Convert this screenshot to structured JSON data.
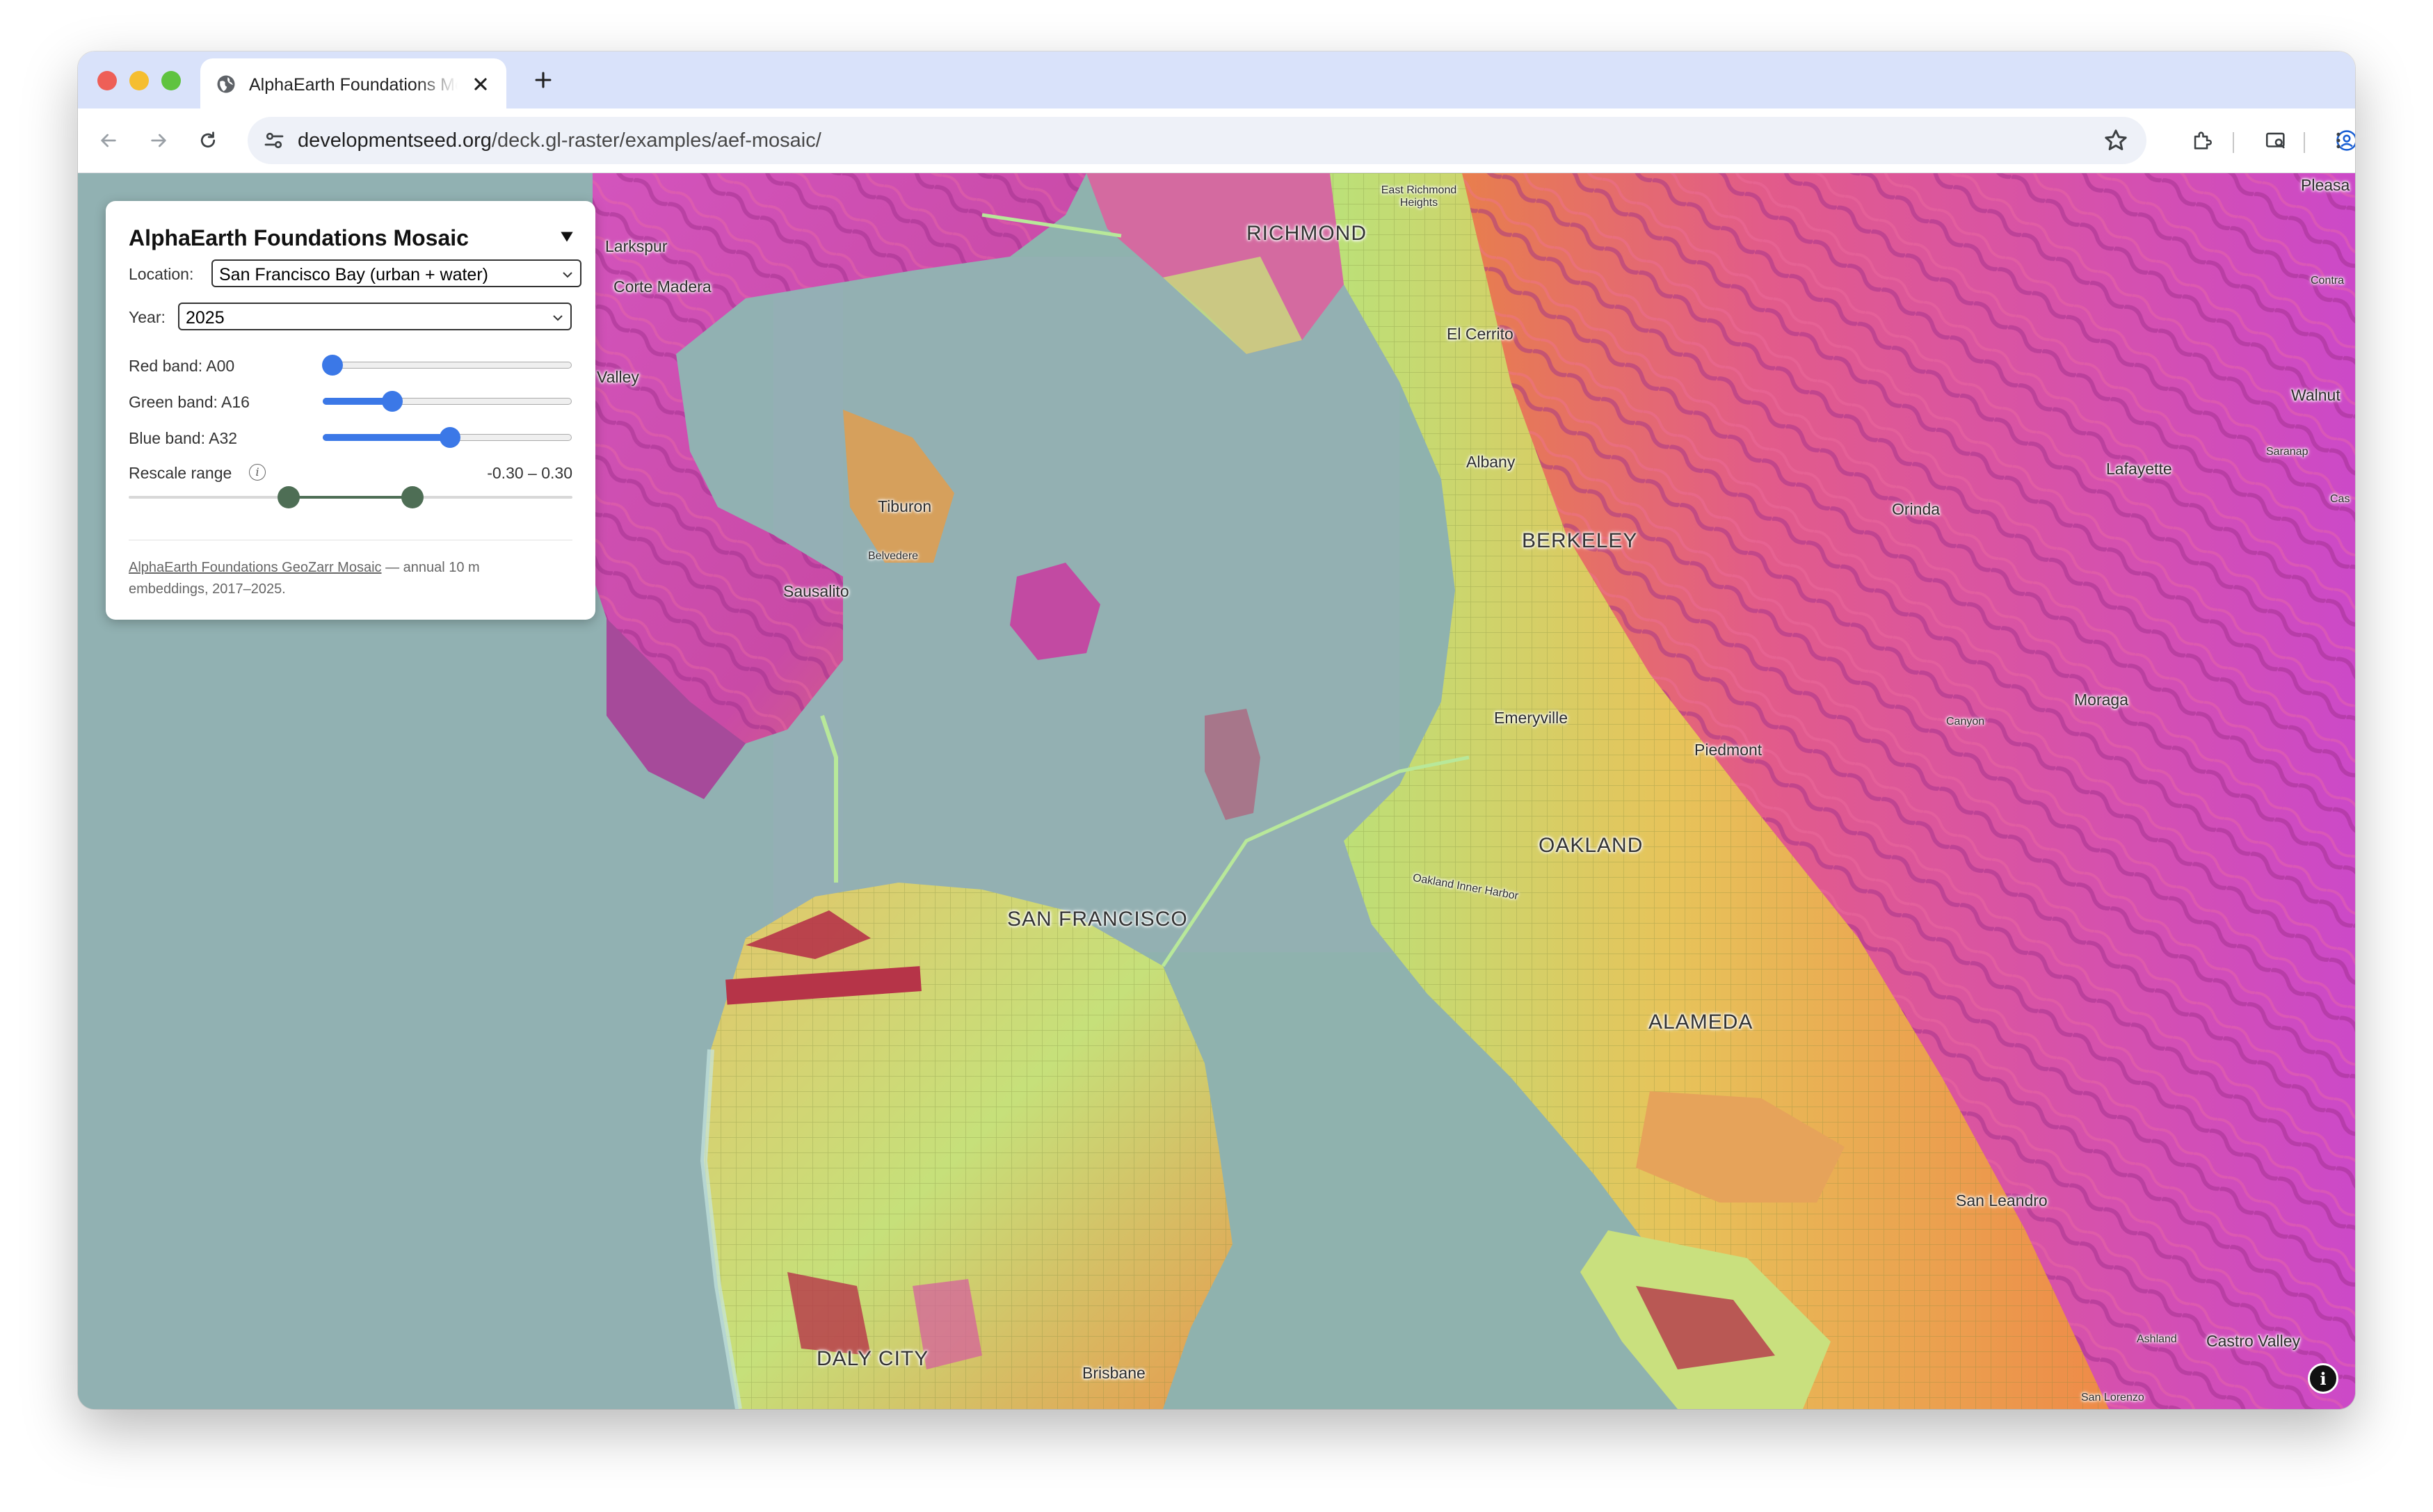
{
  "browser": {
    "tab_title": "AlphaEarth Foundations Mosaic",
    "url_domain": "developmentseed.org",
    "url_path": "/deck.gl-raster/examples/aef-mosaic/"
  },
  "panel": {
    "title": "AlphaEarth Foundations Mosaic",
    "location_label": "Location:",
    "location_value": "San Francisco Bay (urban + water)",
    "year_label": "Year:",
    "year_value": "2025",
    "red_band_label": "Red band: A00",
    "green_band_label": "Green band: A16",
    "blue_band_label": "Blue band: A32",
    "red_band_fraction": 0.04,
    "green_band_fraction": 0.28,
    "blue_band_fraction": 0.51,
    "rescale_label": "Rescale range",
    "rescale_value": "-0.30 – 0.30",
    "rescale_low_fraction": 0.36,
    "rescale_high_fraction": 0.64,
    "footer_link": "AlphaEarth Foundations GeoZarr Mosaic",
    "footer_text": " — annual 10 m embeddings, 2017–2025."
  },
  "map_labels": {
    "richmond": "RICHMOND",
    "east_richmond_heights": "East Richmond Heights",
    "el_cerrito": "El Cerrito",
    "albany": "Albany",
    "berkeley": "BERKELEY",
    "emeryville": "Emeryville",
    "piedmont": "Piedmont",
    "oakland": "OAKLAND",
    "oakland_inner_harbor": "Oakland Inner Harbor",
    "alameda": "ALAMEDA",
    "san_francisco": "SAN FRANCISCO",
    "daly_city": "DALY CITY",
    "brisbane": "Brisbane",
    "larkspur": "Larkspur",
    "corte_madera": "Corte Madera",
    "valley": "Valley",
    "tiburon": "Tiburon",
    "belvedere": "Belvedere",
    "sausalito": "Sausalito",
    "orinda": "Orinda",
    "lafayette": "Lafayette",
    "moraga": "Moraga",
    "canyon": "Canyon",
    "san_leandro": "San Leandro",
    "castro_valley": "Castro Valley",
    "ashland": "Ashland",
    "san_lorenzo": "San Lorenzo",
    "pleasant": "Pleasa",
    "walnut": "Walnut",
    "contra": "Contra",
    "saranap": "Saranap",
    "cas": "Cas"
  },
  "colors": {
    "tab_strip": "#d9e2fa",
    "water": "#8fb2ae",
    "urban_green": "#b9e27a",
    "urban_orange": "#ee9a4a",
    "hills_magenta": "#d24fc8",
    "slider_blue": "#3b78e7",
    "range_green": "#4e6e55"
  },
  "icons": [
    "globe-icon",
    "close-icon",
    "plus-icon",
    "back-arrow-icon",
    "forward-arrow-icon",
    "reload-icon",
    "site-info-icon",
    "star-icon",
    "extensions-icon",
    "cast-icon",
    "profile-icon",
    "more-icon",
    "chevron-down-icon",
    "info-icon"
  ]
}
